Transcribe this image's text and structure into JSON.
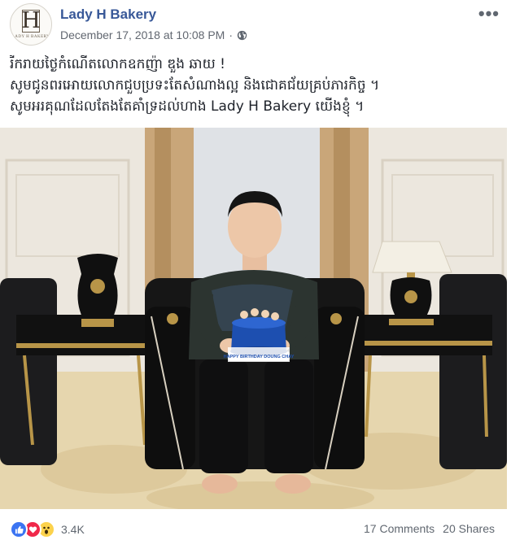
{
  "page": {
    "name": "Lady H Bakery",
    "avatar_letter": "H",
    "avatar_subtext": "LADY H BAKERY"
  },
  "post": {
    "timestamp": "December 17, 2018 at 10:08 PM",
    "separator": "·",
    "privacy_icon": "globe-icon",
    "more_label": "•••",
    "text_lines": [
      "រីករាយថ្ងៃកំណើតលោកឧកញ៉ា ឌួង ឆាយ !",
      "សូមជូនពរអោយលោកជួបប្រទះតែសំណាងល្អ និងជោគជ័យគ្រប់ភារកិច្ច ។",
      "សូមអរគុណដែលតែងតែគាំទ្រដល់ហាង Lady H Bakery យើងខ្ញុំ ។"
    ],
    "cake_text": "HAPPY BIRTHDAY DOUNG CHAY"
  },
  "footer": {
    "reaction_icons": [
      "like-icon",
      "love-icon",
      "wow-icon"
    ],
    "reaction_count": "3.4K",
    "comments": "17 Comments",
    "shares": "20 Shares"
  },
  "colors": {
    "link_blue": "#385898",
    "meta_gray": "#616770",
    "like_blue": "#3b74f2",
    "love_red": "#f0284a",
    "wow_yellow": "#fcd24c"
  }
}
